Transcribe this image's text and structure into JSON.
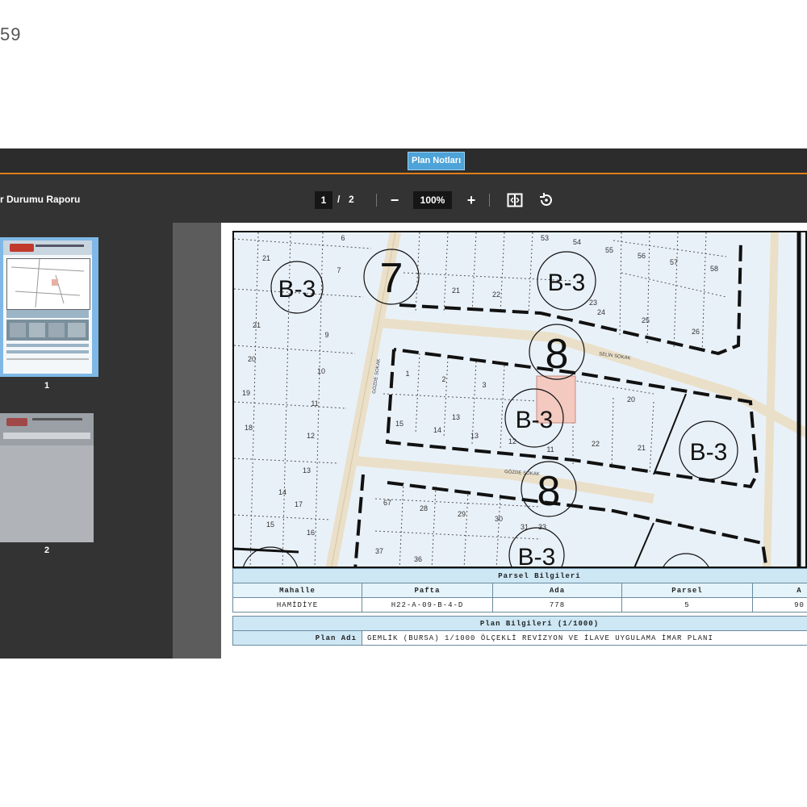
{
  "corner_number": "59",
  "top_tab": {
    "label": "Plan Notları"
  },
  "toolbar": {
    "doc_title": "r Durumu Raporu",
    "current_page": "1",
    "page_separator": "/",
    "total_pages": "2",
    "zoom_out": "−",
    "zoom_level": "100%",
    "zoom_in": "+"
  },
  "thumbnails": [
    {
      "label": "1"
    },
    {
      "label": "2"
    }
  ],
  "map": {
    "zones": [
      "B-3",
      "B-3",
      "B-3",
      "B-3",
      "B-3"
    ],
    "roads": [
      "7",
      "8",
      "8"
    ],
    "street_names": [
      "SELİN SOKAK",
      "GÖZDE SOKAK",
      "GÖZDE SOKAK"
    ],
    "parcels": [
      "6",
      "9",
      "21",
      "7",
      "21",
      "22",
      "53",
      "54",
      "55",
      "56",
      "57",
      "58",
      "23",
      "24",
      "25",
      "26",
      "21",
      "20",
      "19",
      "18",
      "10",
      "11",
      "12",
      "13",
      "14",
      "15",
      "16",
      "17",
      "1",
      "2",
      "3",
      "15",
      "14",
      "13",
      "12",
      "11",
      "22",
      "21",
      "20",
      "13",
      "67",
      "28",
      "29",
      "30",
      "31",
      "33",
      "37",
      "36"
    ]
  },
  "parcel_info": {
    "title": "Parsel Bilgileri",
    "headers": [
      "Mahalle",
      "Pafta",
      "Ada",
      "Parsel",
      "A"
    ],
    "values": [
      "HAMİDİYE",
      "H22-A-09-B-4-D",
      "778",
      "5",
      "90"
    ]
  },
  "plan_info": {
    "title": "Plan Bilgileri (1/1000)",
    "label": "Plan Adı",
    "value": "GEMLİK (BURSA) 1/1000 ÖLÇEKLİ REVİZYON VE İLAVE UYGULAMA İMAR PLANI"
  },
  "colors": {
    "accent": "#e07f1a",
    "tab": "#4ea3d8",
    "parcel_highlight": "#f3c9c0",
    "map_bg": "#e9f1f8"
  }
}
